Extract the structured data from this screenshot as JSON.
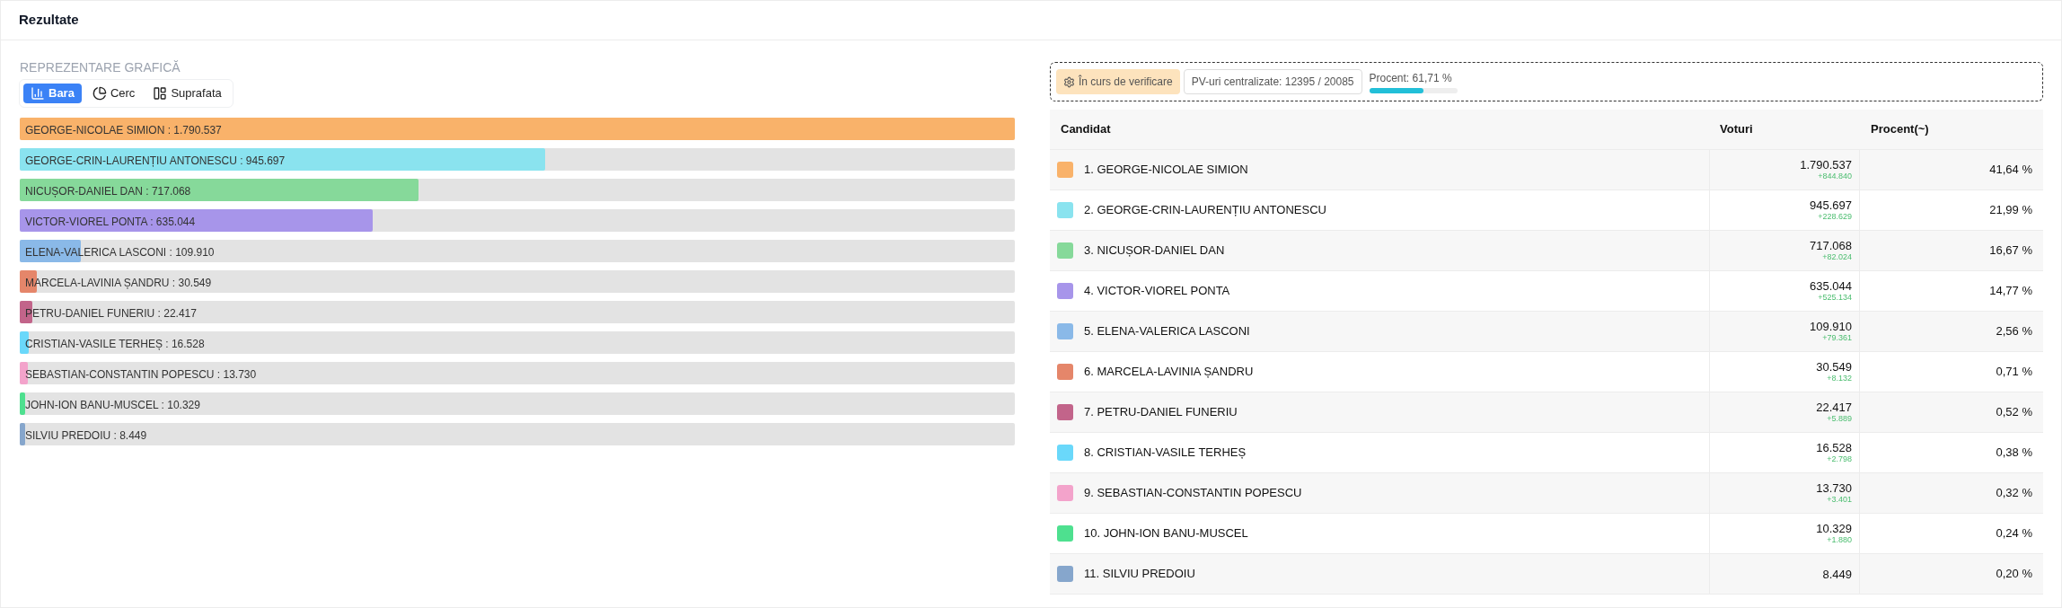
{
  "header": {
    "title": "Rezultate"
  },
  "chart_section": {
    "title": "REPREZENTARE GRAFICĂ",
    "tabs": [
      {
        "label": "Bara",
        "kind": "bar",
        "selected": true
      },
      {
        "label": "Cerc",
        "kind": "pie",
        "selected": false
      },
      {
        "label": "Suprafata",
        "kind": "area",
        "selected": false
      }
    ],
    "bars": [
      {
        "label": "GEORGE-NICOLAE SIMION : 1.790.537",
        "level": 1.0
      },
      {
        "label": "GEORGE-CRIN-LAURENȚIU ANTONESCU : 945.697",
        "level": 0.528
      },
      {
        "label": "NICUȘOR-DANIEL DAN : 717.068",
        "level": 0.4005
      },
      {
        "label": "VICTOR-VIOREL PONTA : 635.044",
        "level": 0.3547
      },
      {
        "label": "ELENA-VALERICA LASCONI : 109.910",
        "level": 0.0614
      },
      {
        "label": "MARCELA-LAVINIA ȘANDRU : 30.549",
        "level": 0.0171
      },
      {
        "label": "PETRU-DANIEL FUNERIU : 22.417",
        "level": 0.0125
      },
      {
        "label": "CRISTIAN-VASILE TERHEȘ : 16.528",
        "level": 0.0092
      },
      {
        "label": "SEBASTIAN-CONSTANTIN POPESCU : 13.730",
        "level": 0.0077
      },
      {
        "label": "JOHN-ION BANU-MUSCEL : 10.329",
        "level": 0.0058
      },
      {
        "label": "SILVIU PREDOIU : 8.449",
        "level": 0.0047
      }
    ]
  },
  "status": {
    "badge": "În curs de verificare",
    "pv": "PV-uri centralizate: 12395 / 20085",
    "progress": {
      "label": "Procent: 61,71 %",
      "level": 0.6171
    }
  },
  "table": {
    "columns": [
      "Candidat",
      "Voturi",
      "Procent(~)"
    ],
    "rows": [
      {
        "name": "1. GEORGE-NICOLAE SIMION",
        "color": "#f9b26a",
        "votes": "1.790.537",
        "delta": "+844.840",
        "percent": "41,64 %"
      },
      {
        "name": "2. GEORGE-CRIN-LAURENȚIU ANTONESCU",
        "color": "#8ae3ef",
        "votes": "945.697",
        "delta": "+228.629",
        "percent": "21,99 %"
      },
      {
        "name": "3. NICUȘOR-DANIEL DAN",
        "color": "#86d99a",
        "votes": "717.068",
        "delta": "+82.024",
        "percent": "16,67 %"
      },
      {
        "name": "4. VICTOR-VIOREL PONTA",
        "color": "#a795ea",
        "votes": "635.044",
        "delta": "+525.134",
        "percent": "14,77 %"
      },
      {
        "name": "5. ELENA-VALERICA LASCONI",
        "color": "#8ab9e8",
        "votes": "109.910",
        "delta": "+79.361",
        "percent": "2,56 %"
      },
      {
        "name": "6. MARCELA-LAVINIA ȘANDRU",
        "color": "#e5866a",
        "votes": "30.549",
        "delta": "+8.132",
        "percent": "0,71 %"
      },
      {
        "name": "7. PETRU-DANIEL FUNERIU",
        "color": "#c2648a",
        "votes": "22.417",
        "delta": "+5.889",
        "percent": "0,52 %"
      },
      {
        "name": "8. CRISTIAN-VASILE TERHEȘ",
        "color": "#6ad8fa",
        "votes": "16.528",
        "delta": "+2.798",
        "percent": "0,38 %"
      },
      {
        "name": "9. SEBASTIAN-CONSTANTIN POPESCU",
        "color": "#f3a3cb",
        "votes": "13.730",
        "delta": "+3.401",
        "percent": "0,32 %"
      },
      {
        "name": "10. JOHN-ION BANU-MUSCEL",
        "color": "#4ee08f",
        "votes": "10.329",
        "delta": "+1.880",
        "percent": "0,24 %"
      },
      {
        "name": "11. SILVIU PREDOIU",
        "color": "#86a6cc",
        "votes": "8.449",
        "percent": "0,20 %"
      }
    ]
  }
}
